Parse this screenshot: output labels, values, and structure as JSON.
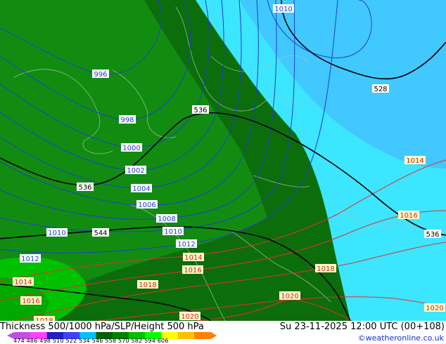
{
  "footer": {
    "title": "Thickness 500/1000 hPa/SLP/Height 500 hPa",
    "valid_time": "Su 23-11-2025 12:00 UTC (00+108)",
    "credit": "©weatheronline.co.uk",
    "scale_values": [
      "474",
      "486",
      "498",
      "510",
      "522",
      "534",
      "546",
      "558",
      "570",
      "582",
      "594",
      "606"
    ],
    "scale_colors": [
      "#c050e0",
      "#ff40ff",
      "#2020c0",
      "#4040ff",
      "#00c0ff",
      "#006000",
      "#008000",
      "#00c000",
      "#00ff00",
      "#ffff00",
      "#ffc000",
      "#ff8000"
    ]
  },
  "colors": {
    "thickness_534_546": "#0b6e0b",
    "thickness_546_558": "#118c11",
    "thickness_558_570": "#00c000",
    "thickness_522_534": "#3ce6ff",
    "thickness_510_522": "#40c8ff",
    "slp_contour": "#1f3fd0",
    "slp_high_contour": "#e03030",
    "height_contour": "#000000"
  },
  "map_labels": {
    "slp": [
      "996",
      "998",
      "1000",
      "1002",
      "1004",
      "1006",
      "1008",
      "1010",
      "1010",
      "1010",
      "1012",
      "1012",
      "1014",
      "1014",
      "1014",
      "1016",
      "1016",
      "1016",
      "1018",
      "1018",
      "1018",
      "1020",
      "1020",
      "1020"
    ],
    "height": [
      "536",
      "536",
      "536",
      "544",
      "528"
    ]
  }
}
